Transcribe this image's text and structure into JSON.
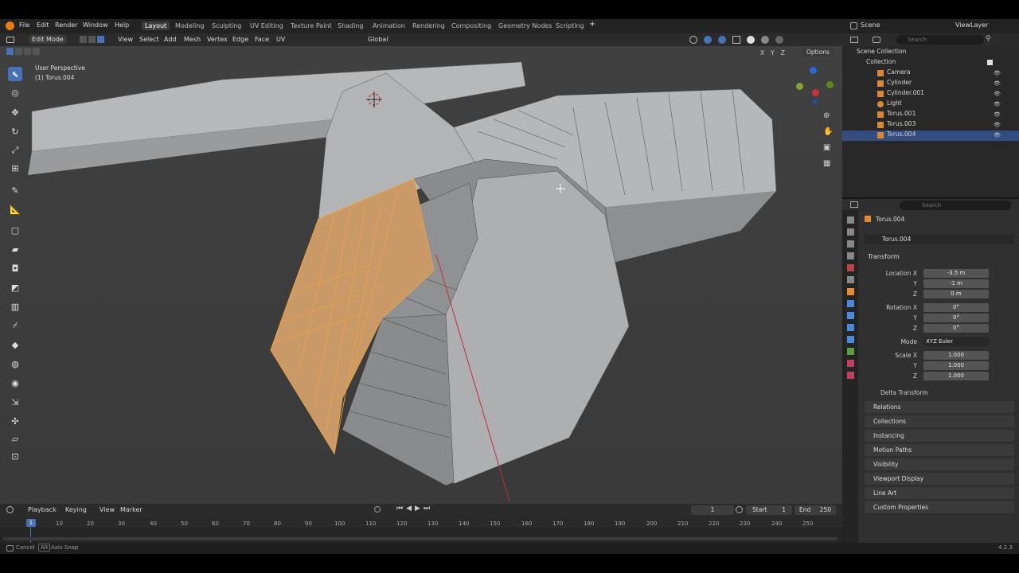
{
  "topbar": {
    "menus": [
      "File",
      "Edit",
      "Render",
      "Window",
      "Help"
    ],
    "workspaces": [
      "Layout",
      "Modeling",
      "Sculpting",
      "UV Editing",
      "Texture Paint",
      "Shading",
      "Animation",
      "Rendering",
      "Compositing",
      "Geometry Nodes",
      "Scripting"
    ],
    "active_workspace": "Layout",
    "scene": "Scene",
    "view_layer": "ViewLayer"
  },
  "viewport_header": {
    "mode": "Edit Mode",
    "menus": [
      "View",
      "Select",
      "Add",
      "Mesh",
      "Vertex",
      "Edge",
      "Face",
      "UV"
    ],
    "orientation": "Global",
    "options": "Options",
    "axes": [
      "X",
      "Y",
      "Z"
    ]
  },
  "viewport": {
    "perspective": "User Perspective",
    "object": "(1) Torus.004"
  },
  "outliner": {
    "search_placeholder": "Search",
    "root": "Scene Collection",
    "collection": "Collection",
    "items": [
      {
        "name": "Camera",
        "icon": "camera-icon"
      },
      {
        "name": "Cylinder",
        "icon": "mesh-icon"
      },
      {
        "name": "Cylinder.001",
        "icon": "mesh-icon"
      },
      {
        "name": "Light",
        "icon": "light-icon"
      },
      {
        "name": "Torus.001",
        "icon": "mesh-icon"
      },
      {
        "name": "Torus.003",
        "icon": "mesh-icon"
      },
      {
        "name": "Torus.004",
        "icon": "mesh-icon",
        "selected": true
      }
    ]
  },
  "properties": {
    "search_placeholder": "Search",
    "object_name": "Torus.004",
    "object_field": "Torus.004",
    "transform_title": "Transform",
    "location_label": "Location X",
    "location": [
      "-3.5 m",
      "-1 m",
      "0 m"
    ],
    "rotation_label": "Rotation X",
    "rotation": [
      "0°",
      "0°",
      "0°"
    ],
    "mode_label": "Mode",
    "mode_value": "XYZ Euler",
    "scale_label": "Scale X",
    "scale": [
      "1.000",
      "1.000",
      "1.000"
    ],
    "axis_y": "Y",
    "axis_z": "Z",
    "delta_transform": "Delta Transform",
    "panels": [
      "Relations",
      "Collections",
      "Instancing",
      "Motion Paths",
      "Visibility",
      "Viewport Display",
      "Line Art",
      "Custom Properties"
    ]
  },
  "timeline": {
    "menus": [
      "Playback",
      "Keying",
      "View",
      "Marker"
    ],
    "current_frame": "1",
    "start_label": "Start",
    "start": "1",
    "end_label": "End",
    "end": "250",
    "ticks": [
      "20",
      "10",
      "20",
      "30",
      "40",
      "50",
      "60",
      "70",
      "80",
      "90",
      "100",
      "110",
      "120",
      "130",
      "140",
      "150",
      "160",
      "170",
      "180",
      "190",
      "200",
      "210",
      "220",
      "230",
      "240",
      "250"
    ],
    "cursor_value": "1"
  },
  "status": {
    "cancel": "Cancel",
    "alt": "Alt",
    "axis_snap": "Axis Snap",
    "version": "4.2.3"
  },
  "colors": {
    "accent": "#4772b3",
    "selected_face": "#e8a04a",
    "mesh": "#a7a9aa",
    "background": "#3f3f3f"
  }
}
